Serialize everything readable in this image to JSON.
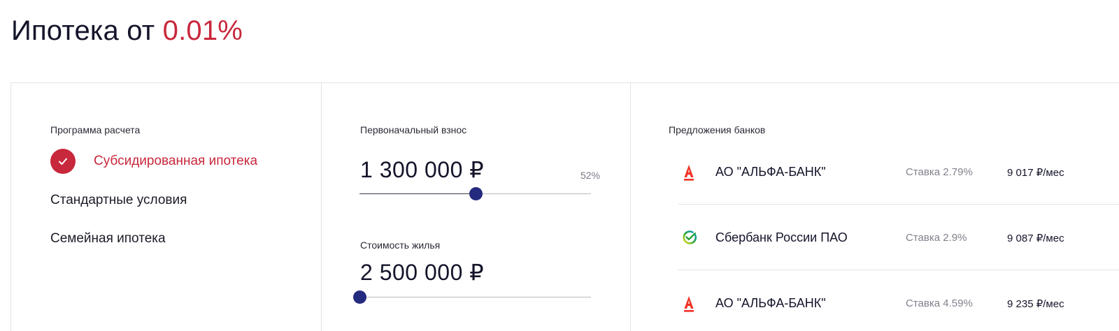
{
  "header": {
    "title_prefix": "Ипотека от",
    "title_rate": "0.01%"
  },
  "program": {
    "label": "Программа расчета",
    "options": [
      {
        "label": "Субсидированная ипотека",
        "selected": true
      },
      {
        "label": "Стандартные условия",
        "selected": false
      },
      {
        "label": "Семейная ипотека",
        "selected": false
      }
    ]
  },
  "down_payment": {
    "label": "Первоначальный взнос",
    "value": "1 300 000 ₽",
    "percent": "52%",
    "slider_fraction": 0.5
  },
  "property_cost": {
    "label": "Стоимость жилья",
    "value": "2 500 000 ₽",
    "slider_fraction": 0.0
  },
  "offers": {
    "label": "Предложения банков",
    "banks": [
      {
        "name": "АО \"АЛЬФА-БАНК\"",
        "rate": "Ставка 2.79%",
        "payment": "9 017 ₽/мес",
        "logo": "alfa-bank-icon"
      },
      {
        "name": "Сбербанк России ПАО",
        "rate": "Ставка 2.9%",
        "payment": "9 087 ₽/мес",
        "logo": "sberbank-icon"
      },
      {
        "name": "АО \"АЛЬФА-БАНК\"",
        "rate": "Ставка 4.59%",
        "payment": "9 235 ₽/мес",
        "logo": "alfa-bank-icon"
      }
    ]
  },
  "colors": {
    "accent_red": "#c8283c",
    "slider_thumb": "#242a7e",
    "alfa_red": "#ef3124",
    "sber_green": "#21a038"
  }
}
